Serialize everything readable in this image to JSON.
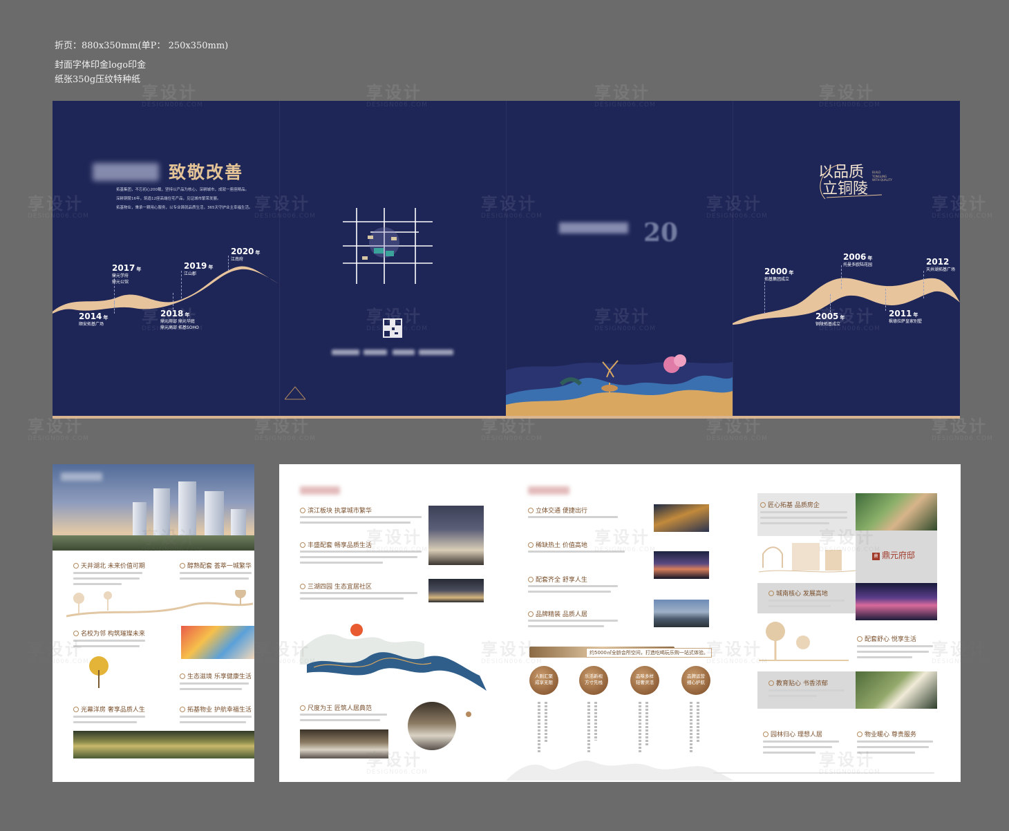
{
  "specs": {
    "size": "折页：880x350mm(单P：  250x350mm)",
    "print": "封面字体印金logo印金",
    "paper": "纸张350g压纹特种纸"
  },
  "watermark": {
    "text": "享设计",
    "sub": "DESIGN006.COM"
  },
  "colors": {
    "navy": "#1e2657",
    "gold": "#d8b491",
    "brown": "#7a4f2c"
  },
  "back_cover": {
    "title": "致敬改善",
    "intro": [
      "拓基集团，不忘初心200载，坚持以产品为核心，深耕城市，成就一座座精品。",
      "深耕铜陵16年，筑造12座高端住宅产品，见证城市繁荣发展。",
      "拓基物业，秉承一颗用心服务，以专业铸就品质生活，365天守护业主幸福生活。"
    ],
    "timeline": [
      {
        "year": "2014",
        "unit": "年",
        "desc": [
          "顺安拓基广场"
        ]
      },
      {
        "year": "2017",
        "unit": "年",
        "desc": [
          "鼎元学府",
          "鼎元公馆"
        ]
      },
      {
        "year": "2018",
        "unit": "年",
        "desc": [
          "鼎元府邸  鼎元华庭",
          "鼎元高邸  拓基SOHO"
        ]
      },
      {
        "year": "2019",
        "unit": "年",
        "desc": [
          "江山郡"
        ]
      },
      {
        "year": "2020",
        "unit": "年",
        "desc": [
          "江南府"
        ]
      }
    ]
  },
  "front_cover": {
    "slogan_top": "以品质",
    "slogan_bottom": "立铜陵",
    "slogan_en": [
      "BUILD",
      "TONGLING",
      "WITH QUALITY"
    ],
    "timeline": [
      {
        "year": "2000",
        "unit": "年",
        "desc": [
          "拓基集团成立"
        ]
      },
      {
        "year": "2005",
        "unit": "年",
        "desc": [
          "铜陵拓基成立"
        ]
      },
      {
        "year": "2006",
        "unit": "年",
        "desc": [
          "托曼多欧陆花园"
        ]
      },
      {
        "year": "2011",
        "unit": "年",
        "desc": [
          "枫德拉萨皇家别墅"
        ]
      },
      {
        "year": "2012",
        "unit": "",
        "desc": [
          "天井湖拓基广场"
        ]
      }
    ]
  },
  "page1": {
    "sections": [
      "天井湖北  未来价值可期",
      "醇熟配套  荟萃一城繁华",
      "名校为邻  构筑璀璨未来",
      "生态滋境  乐享健康生活",
      "光幕洋房  奢享品质人生",
      "拓基物业  护航幸福生活"
    ]
  },
  "page2": {
    "sections": [
      "滨江板块  执掌城市繁华",
      "丰盛配套  畅享品质生活",
      "三湖四园  生态宜居社区",
      "尺度为王  匠筑人居典范"
    ]
  },
  "page3": {
    "sections": [
      "立体交通  便捷出行",
      "稀缺热土  价值高地",
      "配套齐全  舒享人生",
      "品牌精装  品质人居"
    ],
    "band_text": "约5000㎡全龄会所空间，打造吃喝玩乐购一站式体验。",
    "circles": [
      [
        "人则汇聚",
        "成享无限"
      ],
      [
        "乐活新视",
        "方寸先栈"
      ],
      [
        "品味多样",
        "轻奢灵活"
      ],
      [
        "品牌运营",
        "细心护航"
      ]
    ]
  },
  "page4": {
    "sections": [
      "匠心拓基  品质房企",
      "城南核心  发展高地",
      "配套舒心  悦享生活",
      "教育贴心  书香浓郁",
      "园林归心  理想人居",
      "物业暖心  尊贵服务"
    ],
    "logo": "鼎元府邸",
    "seal": "鼎"
  }
}
